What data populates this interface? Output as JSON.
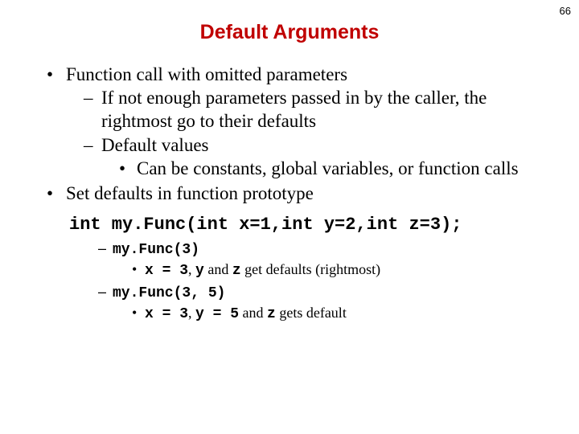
{
  "page_number": "66",
  "title": "Default Arguments",
  "b1": "Function call with omitted parameters",
  "b1_1": "If not enough parameters passed in by the caller, the rightmost go to their defaults",
  "b1_2": "Default values",
  "b1_2_1": "Can be constants, global variables, or function calls",
  "b2": "Set defaults in function prototype",
  "code": "int my.Func(int x=1,int y=2,int z=3);",
  "ex1_call": "my.Func(3)",
  "ex1_x": "x = 3",
  "ex1_mid": ", ",
  "ex1_y": "y",
  "ex1_and1": " and ",
  "ex1_z": "z",
  "ex1_tail": " get defaults (rightmost)",
  "ex2_call": "my.Func(3, 5)",
  "ex2_x": "x = 3",
  "ex2_mid1": ", ",
  "ex2_y": "y = 5",
  "ex2_and": " and ",
  "ex2_z": "z",
  "ex2_tail": " gets default"
}
